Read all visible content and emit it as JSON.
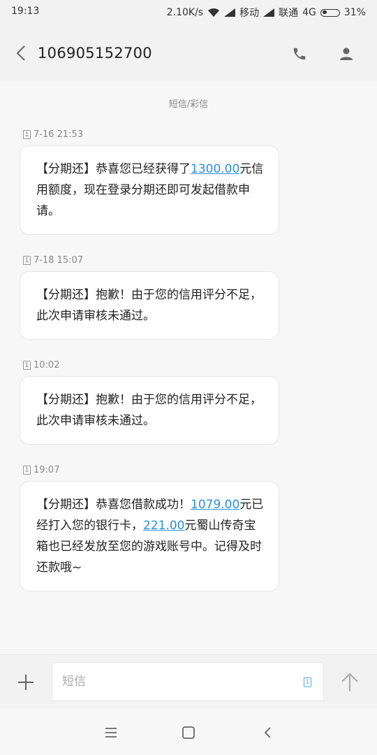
{
  "status_bar": {
    "time": "19:13",
    "speed": "2.10K/s",
    "carrier1": "移动",
    "carrier2": "联通",
    "network": "4G",
    "battery": "31%",
    "battery_level": 0.31
  },
  "header": {
    "title": "106905152700"
  },
  "conversation": {
    "channel_label": "短信/彩信",
    "sim_label": "1",
    "messages": [
      {
        "time": "7-16 21:53",
        "parts": [
          "【分期还】恭喜您已经获得了",
          "1300.00",
          "元信用额度，现在登录分期还即可发起借款申请。"
        ]
      },
      {
        "time": "7-18 15:07",
        "parts": [
          "【分期还】抱歉！由于您的信用评分不足，此次申请审核未通过。"
        ]
      },
      {
        "time": "10:02",
        "parts": [
          "【分期还】抱歉！由于您的信用评分不足，此次申请审核未通过。"
        ]
      },
      {
        "time": "19:07",
        "parts": [
          "【分期还】恭喜您借款成功！",
          "1079.00",
          "元已经打入您的银行卡，",
          "221.00",
          "元蜀山传奇宝箱也已经发放至您的游戏账号中。记得及时还款哦~"
        ]
      }
    ]
  },
  "composer": {
    "placeholder": "短信",
    "sim_label": "1"
  },
  "icons": {
    "back": "chevron-left-icon",
    "call": "phone-icon",
    "contact": "person-icon",
    "add": "plus-icon",
    "send": "arrow-up-icon",
    "accent_link": "#2a8fd7"
  }
}
